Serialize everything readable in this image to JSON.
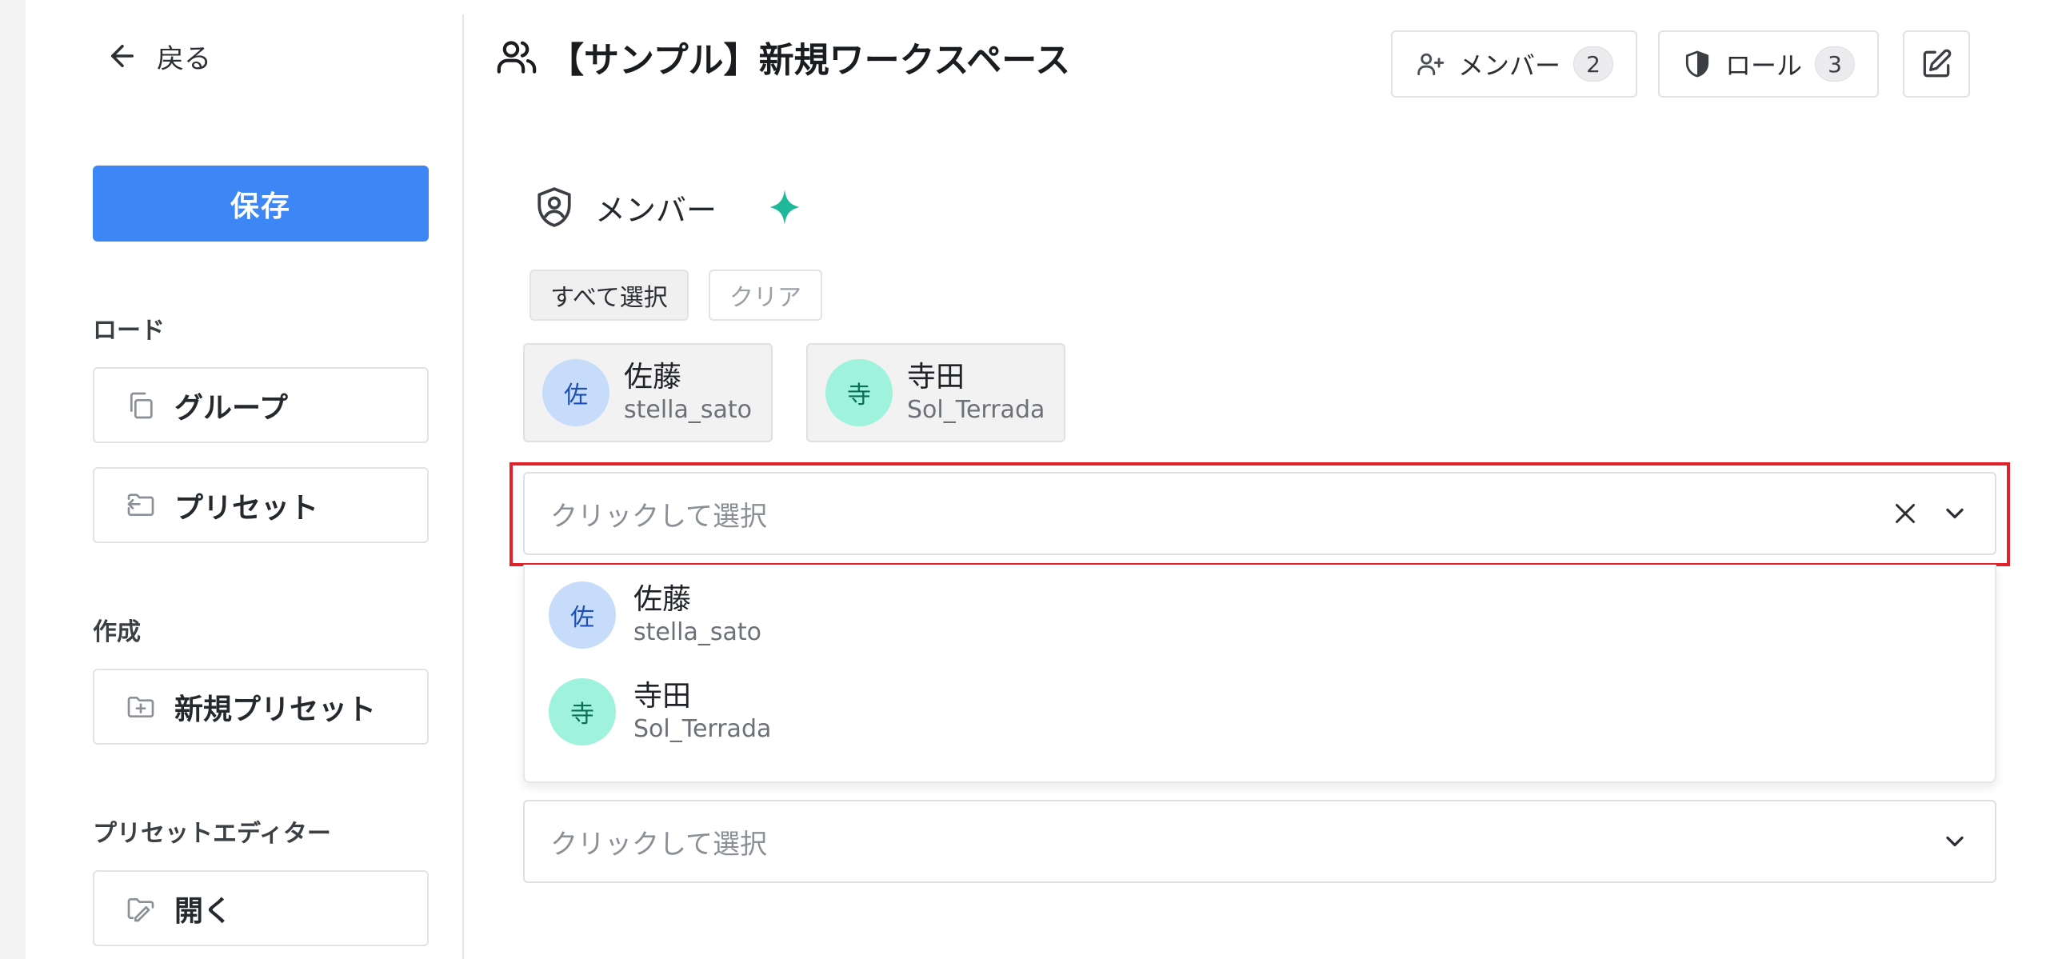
{
  "sidebar": {
    "back_label": "戻る",
    "save_label": "保存",
    "sections": {
      "load": {
        "label": "ロード",
        "group_label": "グループ",
        "preset_label": "プリセット"
      },
      "create": {
        "label": "作成",
        "new_preset_label": "新規プリセット"
      },
      "editor": {
        "label": "プリセットエディター",
        "open_label": "開く"
      }
    }
  },
  "header": {
    "workspace_title": "【サンプル】新規ワークスペース",
    "members_label": "メンバー",
    "members_count": "2",
    "roles_label": "ロール",
    "roles_count": "3"
  },
  "role_section": {
    "title": "メンバー",
    "select_all_label": "すべて選択",
    "clear_label": "クリア",
    "selected_members": [
      {
        "avatar": "佐",
        "name": "佐藤",
        "username": "stella_sato"
      },
      {
        "avatar": "寺",
        "name": "寺田",
        "username": "Sol_Terrada"
      }
    ],
    "select_placeholder": "クリックして選択",
    "dropdown_options": [
      {
        "avatar": "佐",
        "name": "佐藤",
        "username": "stella_sato"
      },
      {
        "avatar": "寺",
        "name": "寺田",
        "username": "Sol_Terrada"
      }
    ],
    "second_select_placeholder": "クリックして選択"
  },
  "colors": {
    "accent": "#3d86f6",
    "highlight": "#e3212b",
    "sparkle": "#1fb89a"
  }
}
